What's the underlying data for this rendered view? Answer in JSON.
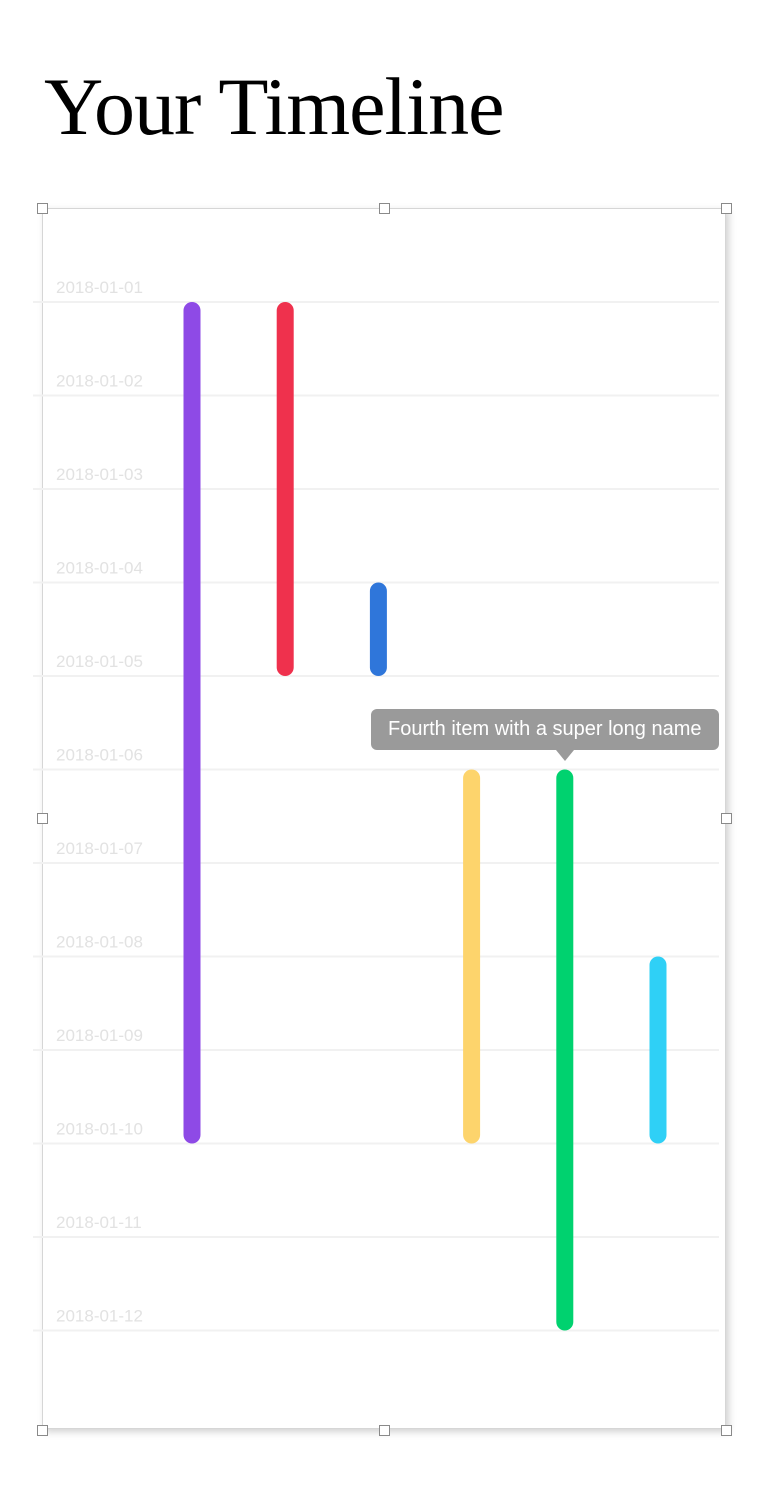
{
  "page": {
    "title": "Your Timeline"
  },
  "chart_data": {
    "type": "timeline",
    "axis": {
      "ticks": [
        "2018-01-01",
        "2018-01-02",
        "2018-01-03",
        "2018-01-04",
        "2018-01-05",
        "2018-01-06",
        "2018-01-07",
        "2018-01-08",
        "2018-01-09",
        "2018-01-10",
        "2018-01-11",
        "2018-01-12"
      ],
      "range": [
        "2018-01-01",
        "2018-01-12"
      ],
      "grid": true
    },
    "items": [
      {
        "start": "2018-01-01",
        "end": "2018-01-10",
        "color": "#8e4ae6"
      },
      {
        "start": "2018-01-01",
        "end": "2018-01-05",
        "color": "#ef314d"
      },
      {
        "start": "2018-01-04",
        "end": "2018-01-05",
        "color": "#2f76da"
      },
      {
        "start": "2018-01-06",
        "end": "2018-01-10",
        "color": "#fdd46c"
      },
      {
        "name": "Fourth item with a super long name",
        "start": "2018-01-06",
        "end": "2018-01-12",
        "color": "#00d26f"
      },
      {
        "start": "2018-01-08",
        "end": "2018-01-10",
        "color": "#2fd0f6"
      }
    ],
    "tooltip": {
      "text": "Fourth item with a super long name",
      "item_index": 4
    }
  }
}
